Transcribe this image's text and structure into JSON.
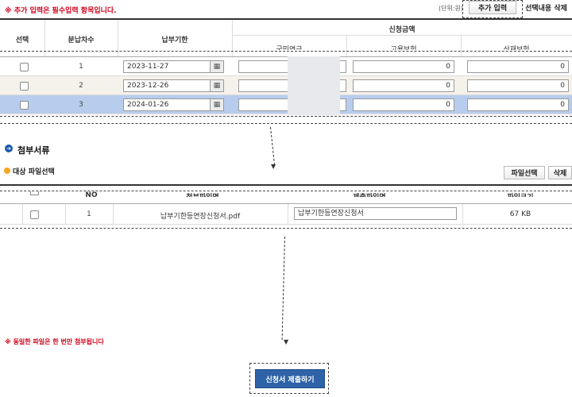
{
  "notice": "※ 추가 입력은 필수입력 항목입니다.",
  "unit": "(단위:원)",
  "buttons": {
    "add_input": "추가 입력",
    "delete_selected": "선택내용 삭제",
    "file_select": "파일선택",
    "delete": "삭제",
    "submit": "신청서 제출하기"
  },
  "installment_table": {
    "headers": {
      "select": "선택",
      "installment": "분납차수",
      "due_date": "납부기한",
      "amount_group": "신청금액",
      "national_tax": "국민연금",
      "employment": "고용보험",
      "industrial": "산재보험"
    },
    "rows": [
      {
        "no": "1",
        "date": "2023-11-27",
        "national": "",
        "employment": "0",
        "industrial": "0",
        "selected": false
      },
      {
        "no": "2",
        "date": "2023-12-26",
        "national": "",
        "employment": "0",
        "industrial": "0",
        "selected": false
      },
      {
        "no": "3",
        "date": "2024-01-26",
        "national": "",
        "employment": "0",
        "industrial": "0",
        "selected": true
      }
    ]
  },
  "attachments": {
    "section_title": "첨부서류",
    "subsection": "대상 파일선택",
    "headers": {
      "no": "NO",
      "file_name": "첨부파일명",
      "submit_name": "제출파일명",
      "size": "파일크기"
    },
    "rows": [
      {
        "no": "1",
        "file_name": "납부기한등연장신청서.pdf",
        "submit_name": "납부기한등연장신청서",
        "size": "67 KB"
      }
    ]
  },
  "duplicate_notice": "※ 동일한 파일은 한 번만 첨부됩니다",
  "icons": {
    "calendar": "calendar-icon",
    "section": "circle-arrow-icon",
    "subsection": "orange-dot-icon"
  },
  "colors": {
    "accent": "#2f63a8",
    "warning": "#d0021b",
    "selected_row": "#b8cdee"
  }
}
